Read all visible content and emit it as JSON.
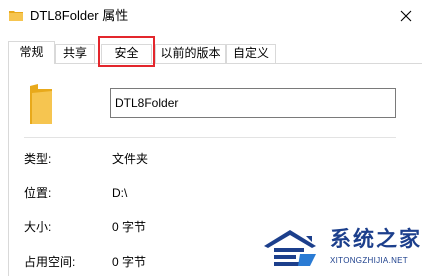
{
  "window": {
    "title": "DTL8Folder 属性",
    "close_icon": "close-icon",
    "title_icon": "folder-icon"
  },
  "tabs": [
    {
      "label": "常规",
      "active": true
    },
    {
      "label": "共享",
      "active": false
    },
    {
      "label": "安全",
      "active": false,
      "highlighted": true
    },
    {
      "label": "以前的版本",
      "active": false
    },
    {
      "label": "自定义",
      "active": false
    }
  ],
  "general": {
    "folder_name": "DTL8Folder",
    "properties": [
      {
        "label": "类型:",
        "value": "文件夹"
      },
      {
        "label": "位置:",
        "value": "D:\\"
      },
      {
        "label": "大小:",
        "value": "0 字节"
      },
      {
        "label": "占用空间:",
        "value": "0 字节"
      }
    ]
  },
  "watermark": {
    "title": "系统之家",
    "url": "XITONGZHIJIA.NET"
  },
  "colors": {
    "highlight": "#e3262c",
    "folder": "#f6c550",
    "border": "#d9d9d9",
    "watermark": "#1c3f8c"
  }
}
